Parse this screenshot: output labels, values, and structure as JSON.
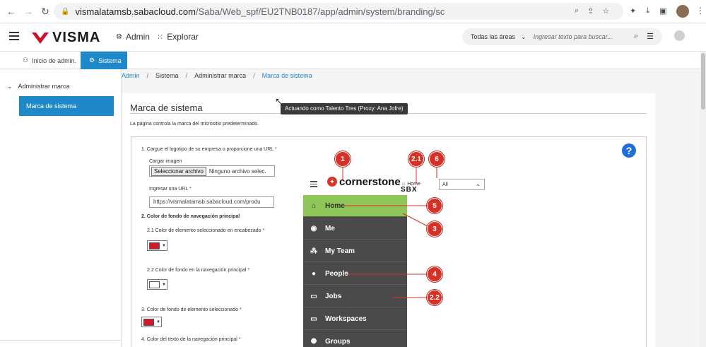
{
  "browser": {
    "url_host": "vismalatamsb.sabacloud.com",
    "url_path": "/Saba/Web_spf/EU2TNB0187/app/admin/system/branding/sc"
  },
  "header": {
    "logo_text": "VISMA",
    "admin_label": "Admin",
    "explore_label": "Explorar",
    "search_scope": "Todas las áreas",
    "search_placeholder": "Ingresar texto para buscar..."
  },
  "tabs": {
    "home_label": "Inicio de admin.",
    "system_label": "Sistema"
  },
  "sidebar": {
    "group_label": "Administrar marca",
    "active_item": "Marca de sistema"
  },
  "breadcrumb": {
    "items": [
      "Admin",
      "Sistema",
      "Administrar marca",
      "Marca de sistema"
    ],
    "separator": "/"
  },
  "tooltip": "Actuando como Talento Tres (Proxy: Ana Jofre)",
  "page": {
    "title": "Marca de sistema",
    "description": "La página controla la marca del micrositio predeterminado."
  },
  "form": {
    "q1_label": "1. Cargue el logotipo de su empresa o proporcione una URL",
    "upload_label": "Cargar imagen",
    "file_button": "Seleccionar archivo",
    "file_status": "Ninguno archivo selec.",
    "url_label": "Ingresar una URL",
    "url_value": "https://vismalatamsb.sabacloud.com/produ",
    "q2_label": "2. Color de fondo de navegación principal",
    "q2_1_label": "2.1 Color de elemento seleccionado en encabezado",
    "q2_1_color": "#d11a2a",
    "q2_2_label": "2.2 Color de fondo en la navegación principal",
    "q2_2_color": "#ffffff",
    "q3_label": "3. Color de fondo de elemento seleccionado",
    "q3_color": "#d11a2a",
    "q4_label": "4. Color del texto de la navegación principal",
    "required_mark": "*",
    "help_label": "?"
  },
  "preview": {
    "brand": "cornerstone",
    "brand_sub": "SBX",
    "home_link": "Home",
    "select_value": "All",
    "nav_items": [
      "Home",
      "Me",
      "My Team",
      "People",
      "Jobs",
      "Workspaces",
      "Groups"
    ],
    "selected_color": "#8fc65a",
    "nav_color": "#4a4a4a",
    "badges": [
      "1",
      "2.1",
      "6",
      "5",
      "3",
      "4",
      "2.2"
    ]
  },
  "colors": {
    "accent": "#1e88c8",
    "badge": "#d93025"
  }
}
